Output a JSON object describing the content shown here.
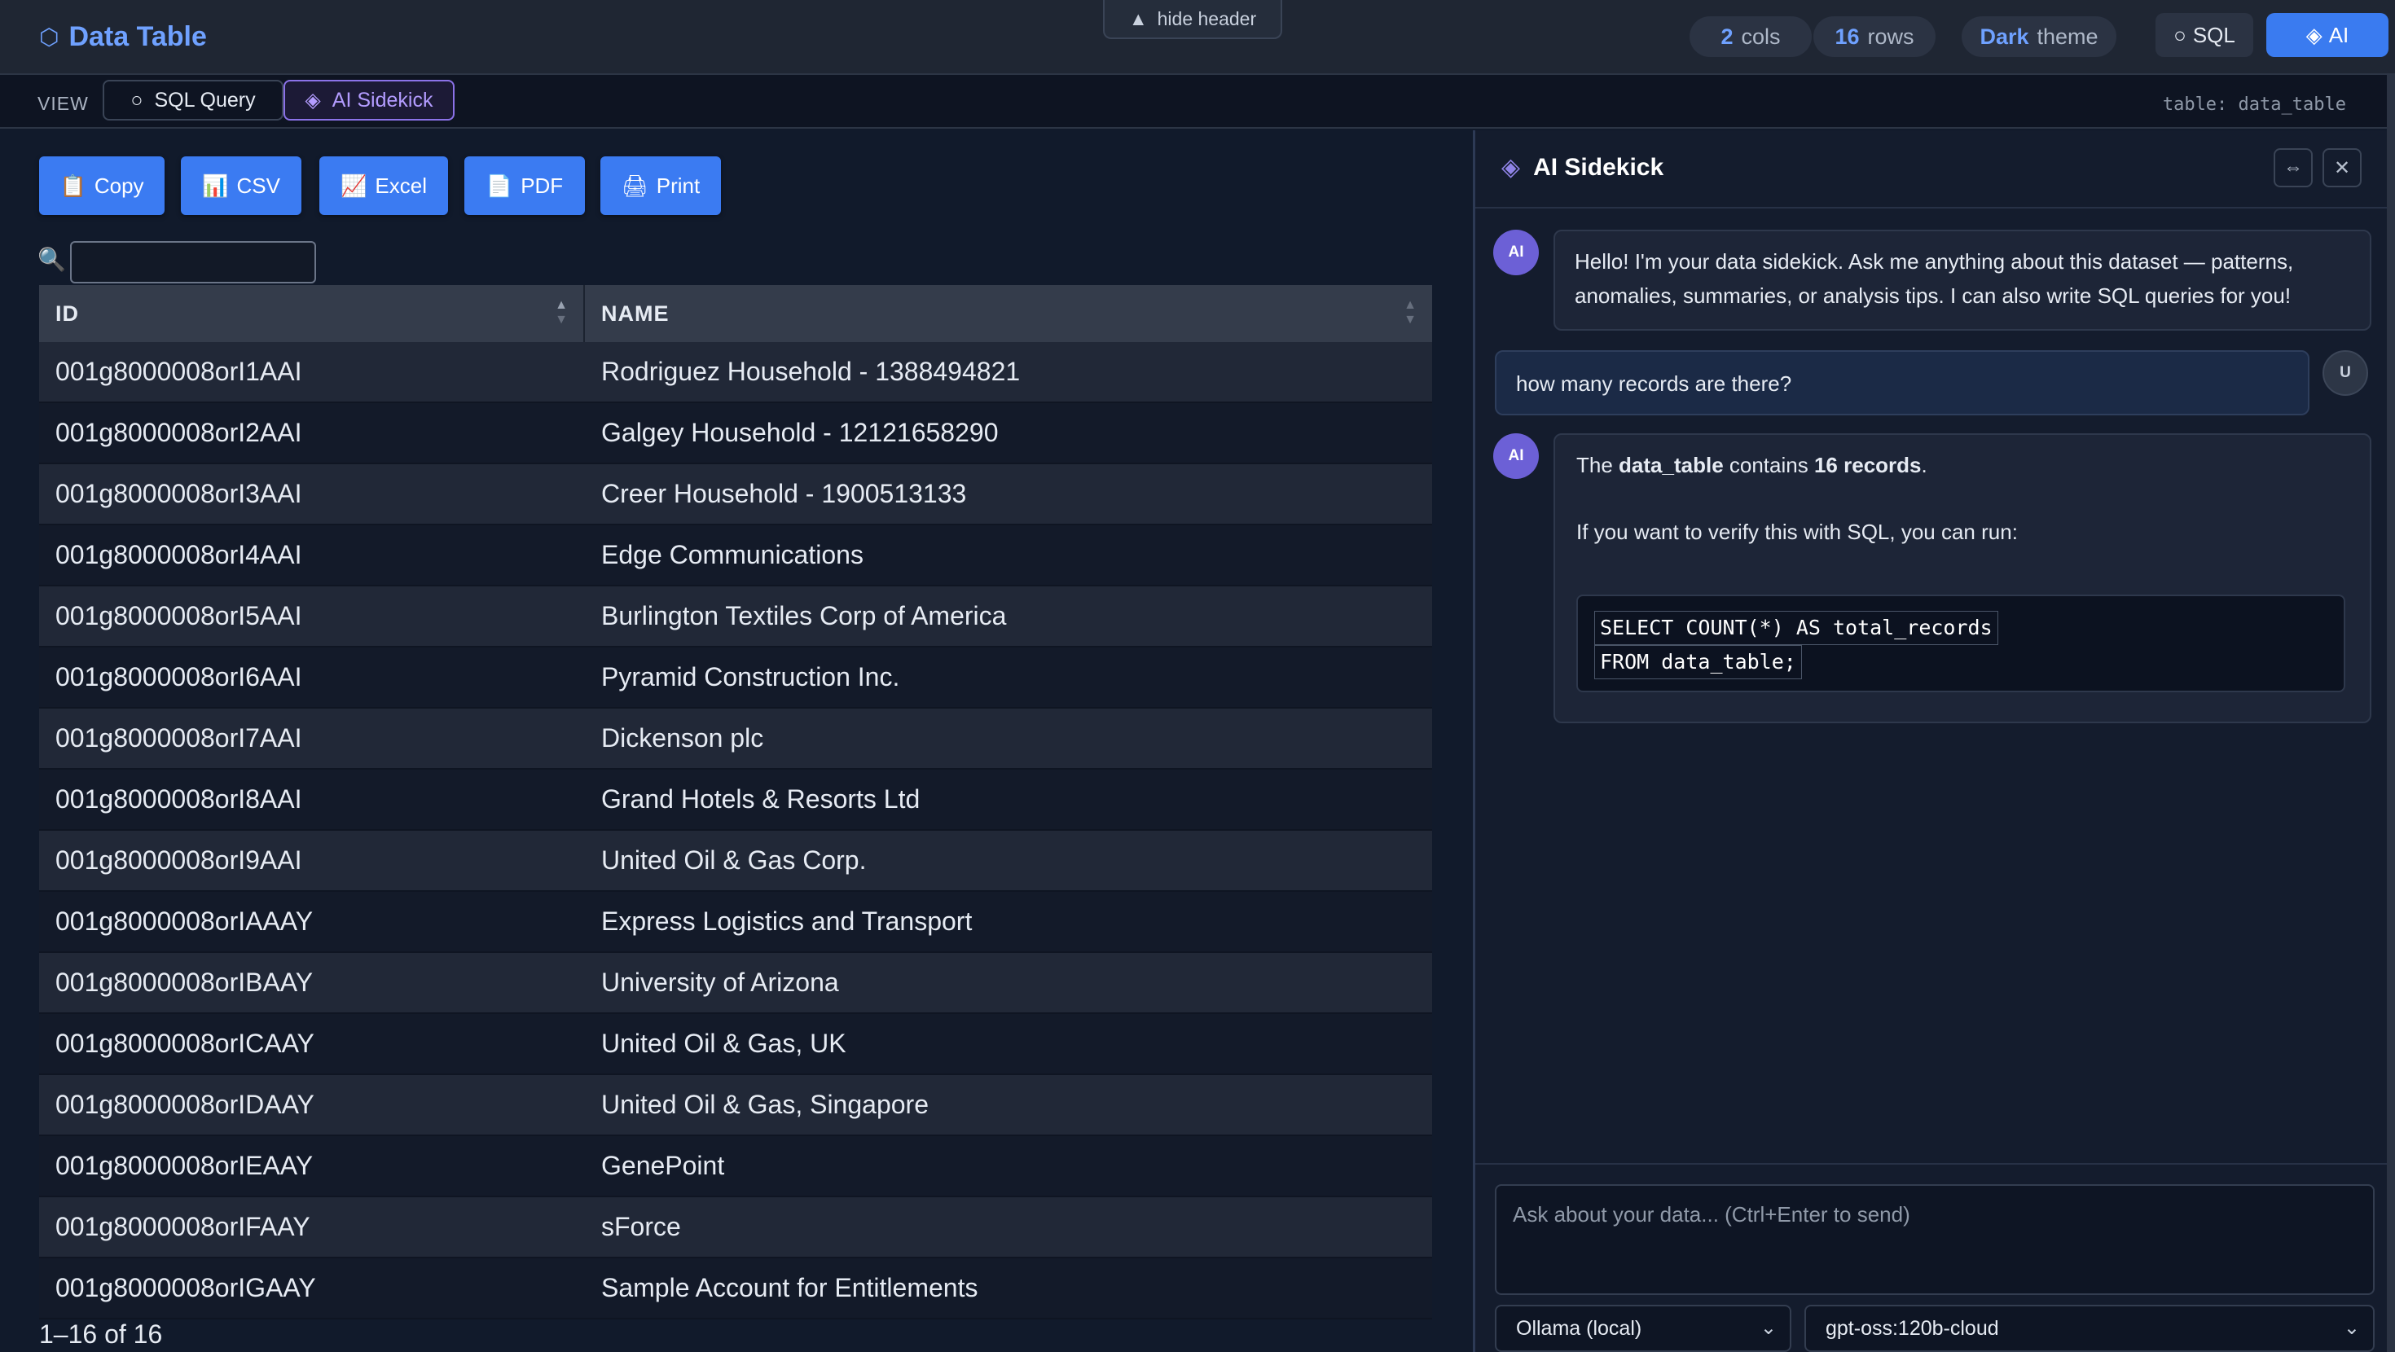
{
  "header": {
    "title": "Data Table",
    "hide_header": "hide header",
    "cols_count": "2",
    "cols_label": "cols",
    "rows_count": "16",
    "rows_label": "rows",
    "theme_name": "Dark",
    "theme_label": "theme",
    "sql_button": "SQL",
    "ai_button": "AI"
  },
  "viewbar": {
    "label": "VIEW",
    "tab_sql": "SQL Query",
    "tab_ai": "AI Sidekick",
    "table_tag": "table: data_table"
  },
  "toolbar": {
    "copy": "Copy",
    "csv": "CSV",
    "excel": "Excel",
    "pdf": "PDF",
    "print": "Print"
  },
  "search": {
    "value": "",
    "placeholder": ""
  },
  "table": {
    "columns": [
      "ID",
      "NAME"
    ],
    "rows": [
      [
        "001g8000008orI1AAI",
        "Rodriguez Household - 1388494821"
      ],
      [
        "001g8000008orI2AAI",
        "Galgey Household - 12121658290"
      ],
      [
        "001g8000008orI3AAI",
        "Creer Household - 1900513133"
      ],
      [
        "001g8000008orI4AAI",
        "Edge Communications"
      ],
      [
        "001g8000008orI5AAI",
        "Burlington Textiles Corp of America"
      ],
      [
        "001g8000008orI6AAI",
        "Pyramid Construction Inc."
      ],
      [
        "001g8000008orI7AAI",
        "Dickenson plc"
      ],
      [
        "001g8000008orI8AAI",
        "Grand Hotels & Resorts Ltd"
      ],
      [
        "001g8000008orI9AAI",
        "United Oil & Gas Corp."
      ],
      [
        "001g8000008orIAAAY",
        "Express Logistics and Transport"
      ],
      [
        "001g8000008orIBAAY",
        "University of Arizona"
      ],
      [
        "001g8000008orICAAY",
        "United Oil & Gas, UK"
      ],
      [
        "001g8000008orIDAAY",
        "United Oil & Gas, Singapore"
      ],
      [
        "001g8000008orIEAAY",
        "GenePoint"
      ],
      [
        "001g8000008orIFAAY",
        "sForce"
      ],
      [
        "001g8000008orIGAAY",
        "Sample Account for Entitlements"
      ]
    ],
    "page_info": "1–16 of 16"
  },
  "sidekick": {
    "title": "AI Sidekick",
    "ai_avatar": "AI",
    "user_avatar": "U",
    "greeting": "Hello! I'm your data sidekick. Ask me anything about this dataset — patterns, anomalies, summaries, or analysis tips. I can also write SQL queries for you!",
    "user_question": "how many records are there?",
    "answer_prefix": "The",
    "answer_table": "data_table",
    "answer_mid": "contains",
    "answer_count": "16 records",
    "answer_suffix": ".",
    "answer_verify": "If you want to verify this with SQL, you can run:",
    "code_line_1": "SELECT COUNT(*) AS total_records",
    "code_line_2": "FROM data_table;",
    "input_placeholder": "Ask about your data... (Ctrl+Enter to send)",
    "provider": "Ollama (local)",
    "model": "gpt-oss:120b-cloud"
  },
  "colors": {
    "accent": "#3b7bf2",
    "brand": "#6fa1ff",
    "ai_purple": "#8b72e8",
    "background": "#111a2b"
  }
}
